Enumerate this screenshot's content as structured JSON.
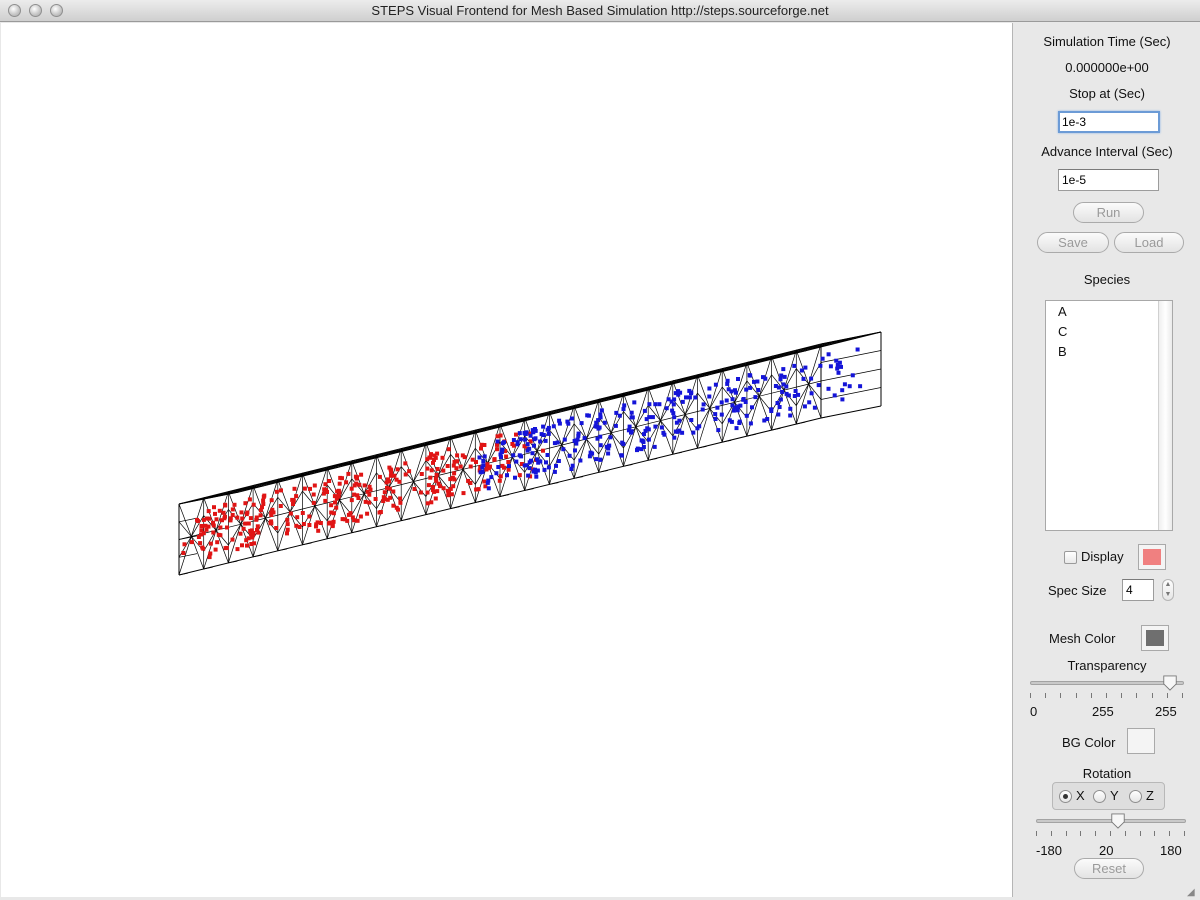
{
  "window": {
    "title": "STEPS Visual Frontend for Mesh Based Simulation http://steps.sourceforge.net"
  },
  "panel": {
    "sim_time_label": "Simulation Time (Sec)",
    "sim_time_value": "0.000000e+00",
    "stop_at_label": "Stop at (Sec)",
    "stop_at_value": "1e-3",
    "advance_label": "Advance Interval (Sec)",
    "advance_value": "1e-5",
    "run_label": "Run",
    "save_label": "Save",
    "load_label": "Load",
    "species_label": "Species",
    "species": [
      "A",
      "C",
      "B"
    ],
    "display_label": "Display",
    "display_checked": false,
    "display_color": "#f08080",
    "spec_size_label": "Spec Size",
    "spec_size_value": "4",
    "mesh_color_label": "Mesh Color",
    "mesh_color": "#6f6f6f",
    "transparency_label": "Transparency",
    "transparency": {
      "min": "0",
      "value": "255",
      "max": "255"
    },
    "bg_color_label": "BG Color",
    "bg_color": "#f4f4f4",
    "rotation_label": "Rotation",
    "axes": [
      {
        "label": "X",
        "selected": true
      },
      {
        "label": "Y",
        "selected": false
      },
      {
        "label": "Z",
        "selected": false
      }
    ],
    "rotation": {
      "min": "-180",
      "value": "20",
      "max": "180"
    },
    "reset_label": "Reset"
  },
  "scene": {
    "species_colors": {
      "A": "#e01414",
      "B": "#1414d8"
    },
    "mesh_line_color": "#000000"
  }
}
